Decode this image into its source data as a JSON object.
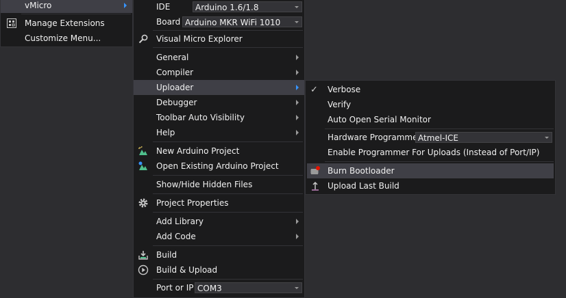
{
  "menu_vmicro": {
    "title": "vMicro",
    "items": [
      {
        "label": "Manage Extensions",
        "icon": "extensions-icon"
      },
      {
        "label": "Customize Menu..."
      }
    ]
  },
  "menu_main": {
    "ide_label": "IDE",
    "ide_value": "Arduino 1.6/1.8",
    "board_label": "Board",
    "board_value": "Arduino MKR WiFi 1010",
    "explorer": "Visual Micro Explorer",
    "general": "General",
    "compiler": "Compiler",
    "uploader": "Uploader",
    "debugger": "Debugger",
    "toolbar_auto_visibility": "Toolbar Auto Visibility",
    "help": "Help",
    "new_project": "New Arduino Project",
    "open_project": "Open Existing Arduino Project",
    "show_hide_files": "Show/Hide Hidden Files",
    "project_properties": "Project Properties",
    "add_library": "Add Library",
    "add_code": "Add Code",
    "build": "Build",
    "build_upload": "Build & Upload",
    "port_label": "Port or IP",
    "port_value": "COM3"
  },
  "menu_uploader": {
    "verbose": "Verbose",
    "verify": "Verify",
    "auto_open_serial": "Auto Open Serial Monitor",
    "hardware_programmer_label": "Hardware Programmer",
    "hardware_programmer_value": "Atmel-ICE",
    "enable_programmer": "Enable Programmer For Uploads (Instead of Port/IP)",
    "burn_bootloader": "Burn Bootloader",
    "upload_last_build": "Upload Last Build"
  },
  "colors": {
    "menu_bg": "#1b1b1c",
    "highlight": "#3f3f46",
    "text": "#f1f1f1",
    "submenu_arrow_active": "#3794ff",
    "background": "#2d2d30"
  }
}
